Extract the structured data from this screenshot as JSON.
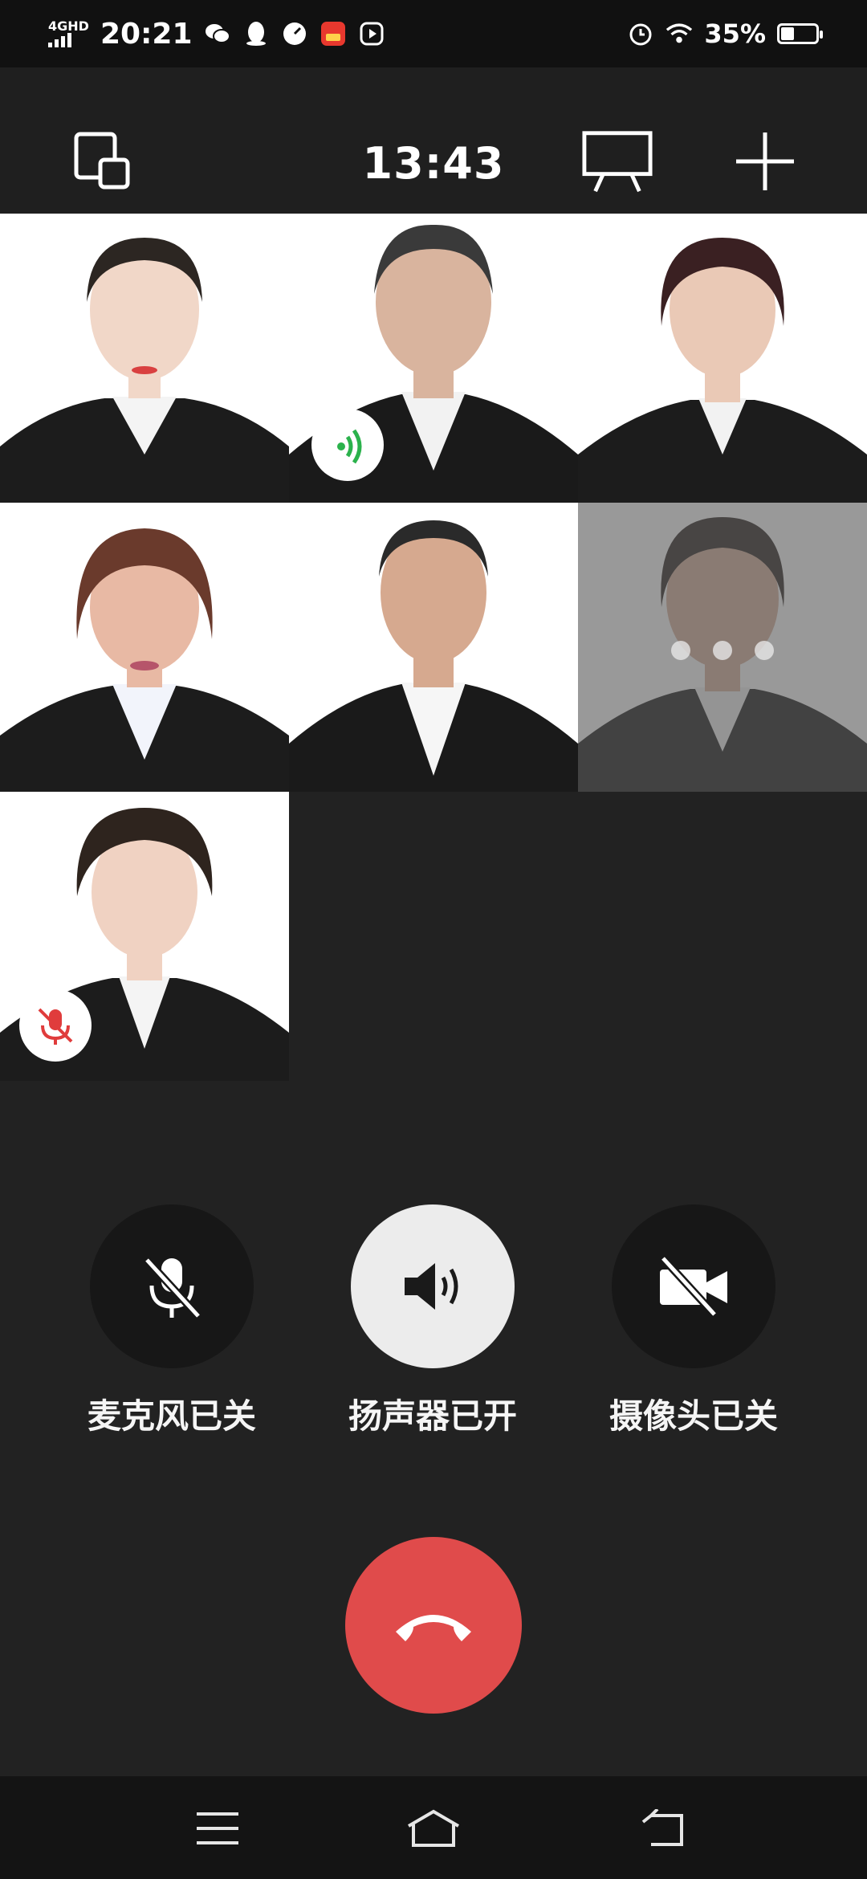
{
  "status_bar": {
    "network": "4GHD",
    "time": "20:21",
    "battery": "35%",
    "battery_level": 0.35,
    "left_icons": [
      "wechat-icon",
      "qq-icon",
      "speedometer-icon",
      "shopping-app-icon",
      "video-app-icon"
    ],
    "right_icons": [
      "alarm-icon",
      "wifi-icon",
      "battery-icon"
    ]
  },
  "call": {
    "timer": "13:43",
    "top_buttons": [
      "switch-window-icon",
      "screen-share-icon",
      "add-participant-icon"
    ]
  },
  "participants": [
    {
      "hair": "#2c2622",
      "skin": "#f1d7c8",
      "tone": "#ffffff",
      "status": "none"
    },
    {
      "hair": "#3a3a3a",
      "skin": "#d9b49e",
      "tone": "#ffffff",
      "status": "speaking"
    },
    {
      "hair": "#3a2022",
      "skin": "#eac9b6",
      "tone": "#ffffff",
      "status": "none"
    },
    {
      "hair": "#6a3a2c",
      "skin": "#e8b9a4",
      "tone": "#ffffff",
      "status": "none"
    },
    {
      "hair": "#2a2a2a",
      "skin": "#d6a98f",
      "tone": "#ffffff",
      "status": "none"
    },
    {
      "hair": "#2a2220",
      "skin": "#d7b19c",
      "tone": "#ffffff",
      "status": "connecting"
    },
    {
      "hair": "#2e241e",
      "skin": "#f0d2c2",
      "tone": "#ffffff",
      "status": "muted"
    }
  ],
  "controls": {
    "mic": {
      "label": "麦克风已关",
      "icon": "mic-off-icon"
    },
    "speaker": {
      "label": "扬声器已开",
      "icon": "speaker-on-icon"
    },
    "camera": {
      "label": "摄像头已关",
      "icon": "camera-off-icon"
    },
    "hangup_icon": "phone-hangup-icon"
  },
  "nav": [
    "menu-icon",
    "home-icon",
    "back-icon"
  ],
  "colors": {
    "background": "#222222",
    "hangup": "#e04b4b",
    "speaking_green": "#2bb24c",
    "muted_red": "#e03c3c"
  }
}
